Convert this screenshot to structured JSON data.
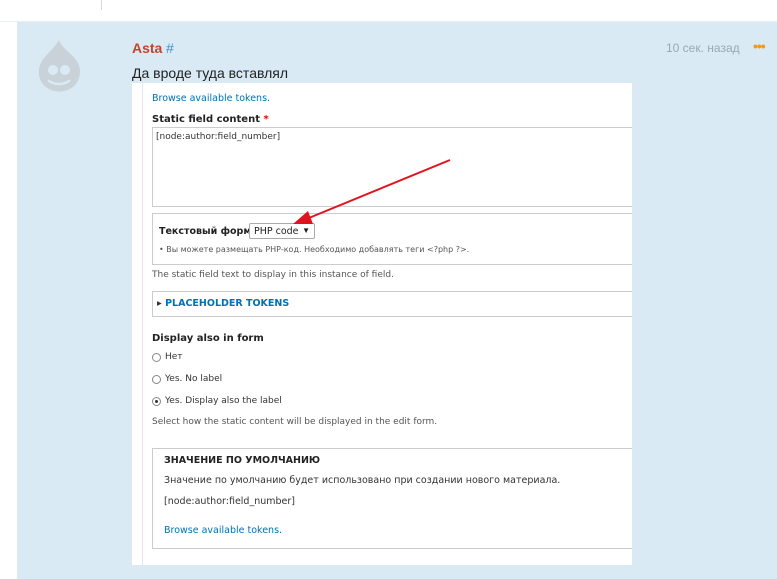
{
  "comment": {
    "author": "Asta",
    "permalink": "#",
    "time": "10 сек. назад",
    "menu_glyph": "•••",
    "text": "Да вроде туда вставлял"
  },
  "colors": {
    "panel": "#d9eaf5",
    "author": "#c8402a",
    "link": "#3f8fcf",
    "menu": "#f29a18",
    "arrow": "#e0141e",
    "drupal_link": "#0071b3"
  },
  "screenshot": {
    "browse_tokens_top": "Browse available tokens.",
    "static_field_label": "Static field content",
    "required_mark": "*",
    "static_field_value": "[node:author:field_number]",
    "format_label": "Текстовый формат",
    "format_value": "PHP code",
    "format_hint": "Вы можете размещать PHP-код. Необходимо добавлять теги <?php ?>.",
    "static_field_desc": "The static field text to display in this instance of field.",
    "placeholder_tokens": "PLACEHOLDER TOKENS",
    "display_also_label": "Display also in form",
    "radio_options": [
      "Нет",
      "Yes. No label",
      "Yes. Display also the label"
    ],
    "radio_selected": "Yes. Display also the label",
    "display_desc": "Select how the static content will be displayed in the edit form.",
    "default_title": "ЗНАЧЕНИЕ ПО УМОЛЧАНИЮ",
    "default_desc": "Значение по умолчанию будет использовано при создании нового материала.",
    "default_value": "[node:author:field_number]",
    "browse_tokens_bottom": "Browse available tokens."
  }
}
